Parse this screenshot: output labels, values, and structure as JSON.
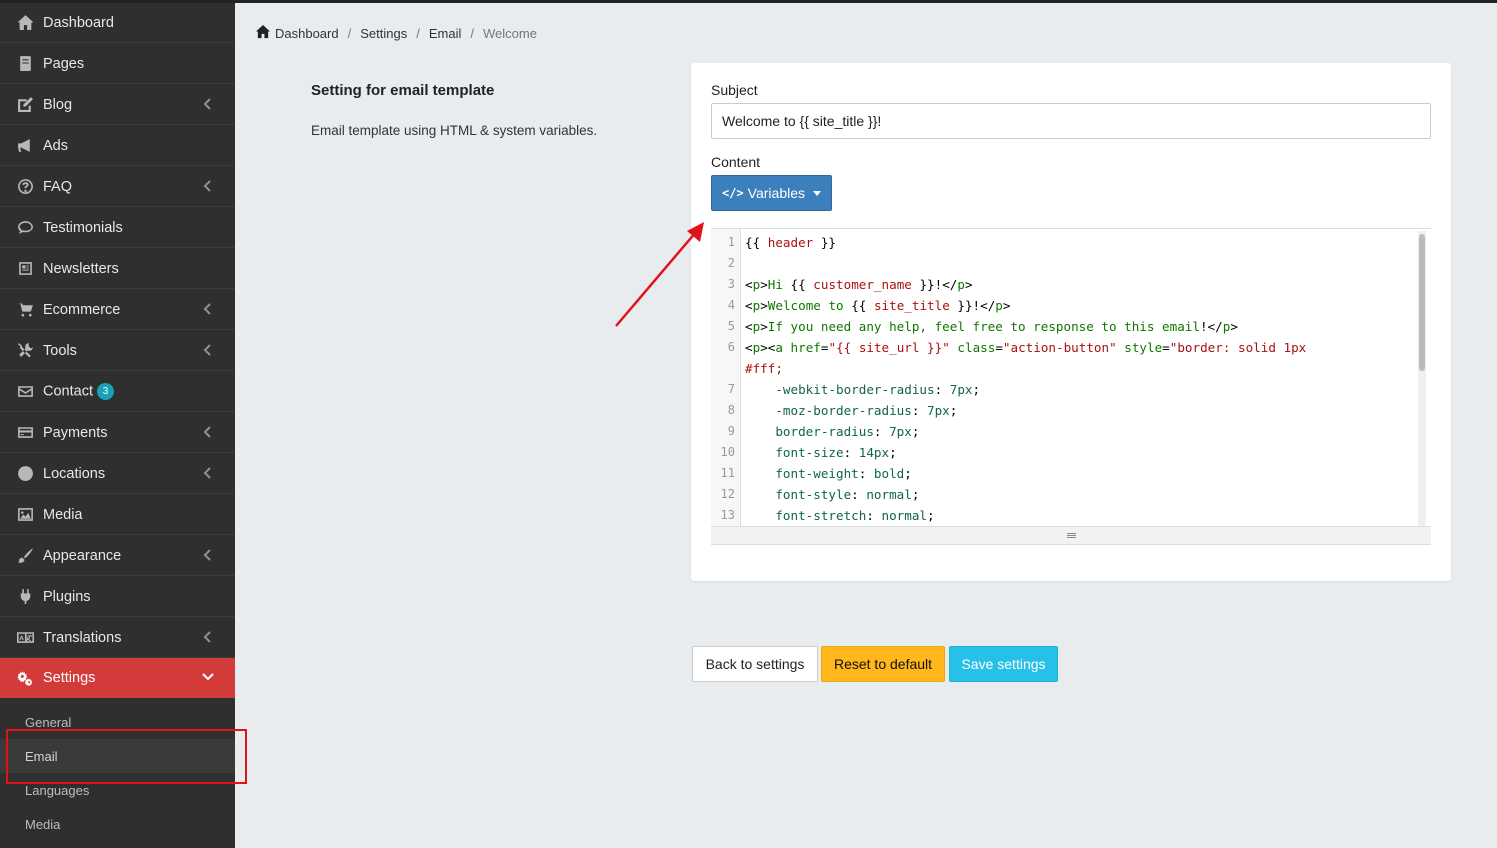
{
  "sidebar": {
    "items": [
      {
        "label": "Dashboard",
        "icon": "home-icon"
      },
      {
        "label": "Pages",
        "icon": "pages-icon"
      },
      {
        "label": "Blog",
        "icon": "edit-icon",
        "has_children": true
      },
      {
        "label": "Ads",
        "icon": "bullhorn-icon"
      },
      {
        "label": "FAQ",
        "icon": "question-icon",
        "has_children": true
      },
      {
        "label": "Testimonials",
        "icon": "comment-icon"
      },
      {
        "label": "Newsletters",
        "icon": "newspaper-icon"
      },
      {
        "label": "Ecommerce",
        "icon": "cart-icon",
        "has_children": true
      },
      {
        "label": "Tools",
        "icon": "tools-icon",
        "has_children": true
      },
      {
        "label": "Contact",
        "icon": "envelope-icon",
        "badge": "3"
      },
      {
        "label": "Payments",
        "icon": "credit-card-icon",
        "has_children": true
      },
      {
        "label": "Locations",
        "icon": "globe-icon",
        "has_children": true
      },
      {
        "label": "Media",
        "icon": "image-icon"
      },
      {
        "label": "Appearance",
        "icon": "brush-icon",
        "has_children": true
      },
      {
        "label": "Plugins",
        "icon": "plug-icon"
      },
      {
        "label": "Translations",
        "icon": "language-icon",
        "has_children": true
      },
      {
        "label": "Settings",
        "icon": "cogs-icon",
        "has_children": true,
        "active": true
      }
    ],
    "settings_sub": [
      {
        "label": "General"
      },
      {
        "label": "Email",
        "current": true
      },
      {
        "label": "Languages"
      },
      {
        "label": "Media"
      }
    ]
  },
  "breadcrumb": [
    "Dashboard",
    "Settings",
    "Email",
    "Welcome"
  ],
  "section": {
    "title": "Setting for email template",
    "description": "Email template using HTML & system variables."
  },
  "form": {
    "subject_label": "Subject",
    "subject_value": "Welcome to {{ site_title }}!",
    "content_label": "Content",
    "variables_button": "Variables"
  },
  "editor": {
    "line_numbers": [
      "1",
      "2",
      "3",
      "4",
      "5",
      "6",
      "",
      "7",
      "8",
      "9",
      "10",
      "11",
      "12",
      "13"
    ]
  },
  "buttons": {
    "back": "Back to settings",
    "reset": "Reset to default",
    "save": "Save settings"
  },
  "colors": {
    "sidebar_bg": "#2f2f2f",
    "active_item": "#d33a3a",
    "variables_btn": "#3c7fbd",
    "reset_btn": "#ffb71b",
    "save_btn": "#27c1e8",
    "annotation": "#e0131a"
  }
}
